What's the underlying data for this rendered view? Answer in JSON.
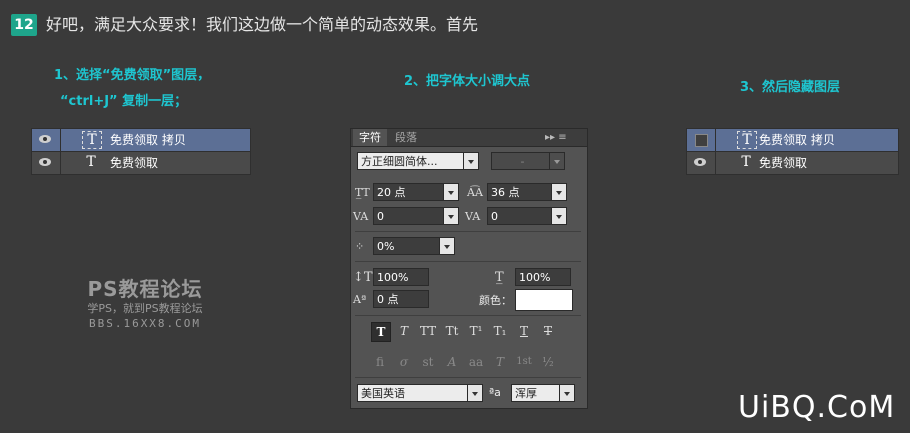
{
  "step": {
    "number": "12",
    "headline": "好吧，满足大众要求！我们这边做一个简单的动态效果。首先"
  },
  "captions": {
    "c1_line1": "1、选择“免费领取”图层，",
    "c1_line2": "“ctrl+J” 复制一层；",
    "c2": "2、把字体大小调大点",
    "c3": "3、然后隐藏图层"
  },
  "layers_left": [
    {
      "name": "免费领取 拷贝",
      "selected": true,
      "visible": true
    },
    {
      "name": "免费领取",
      "selected": false,
      "visible": true
    }
  ],
  "layers_right": [
    {
      "name": "免费领取 拷贝",
      "selected": true,
      "visible": false
    },
    {
      "name": "免费领取",
      "selected": false,
      "visible": true
    }
  ],
  "char_panel": {
    "tabs": [
      "字符",
      "段落"
    ],
    "menu_icons": "▸▸  ≡",
    "font_family": "方正细圆简体...",
    "font_style": "-",
    "font_size": "20 点",
    "leading": "36 点",
    "kerning": "0",
    "tracking": "0",
    "tsume": "0%",
    "vertical_scale": "100%",
    "horizontal_scale": "100%",
    "baseline_shift": "0 点",
    "color_label": "颜色：",
    "color_value": "#ffffff",
    "style_buttons": [
      "T",
      "T",
      "TT",
      "Tt",
      "T¹",
      "T₁",
      "T",
      "T"
    ],
    "opentype_buttons": [
      "fi",
      "σ",
      "st",
      "A",
      "aa",
      "T",
      "1st",
      "½"
    ],
    "language": "美国英语",
    "aa_label": "ªa",
    "anti_alias": "浑厚"
  },
  "watermark": {
    "title": "PS教程论坛",
    "subtitle": "学PS，就到PS教程论坛",
    "url": "BBS.16XX8.COM"
  },
  "logo": "UiBQ.CoM",
  "colors": {
    "accent": "#1ec6d0",
    "step_bg": "#1ea58b",
    "layer_selected": "#5c6f95"
  }
}
